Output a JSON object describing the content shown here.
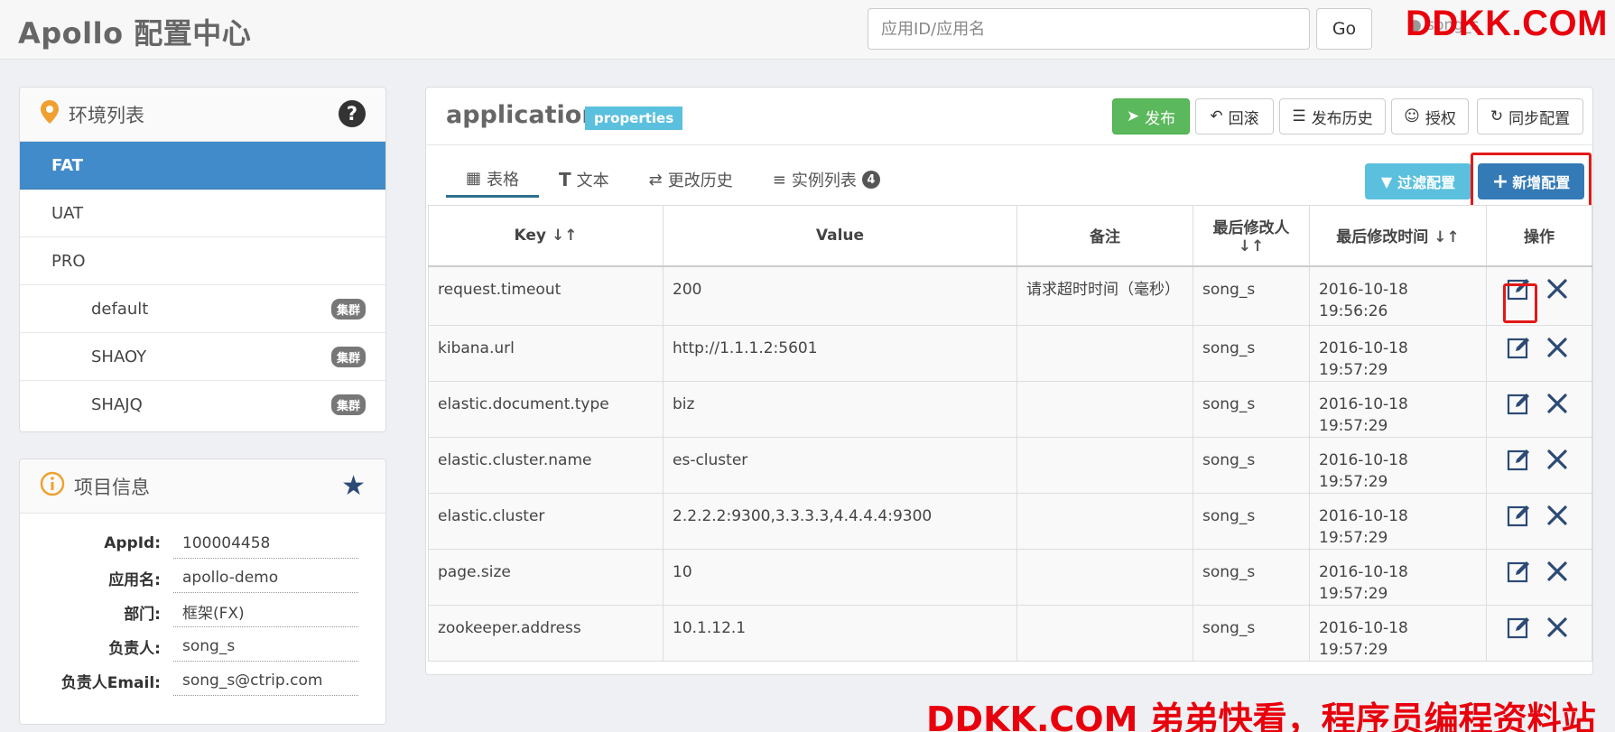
{
  "navbar": {
    "brand": "Apollo 配置中心",
    "search_placeholder": "应用ID/应用名",
    "go_label": "Go",
    "user": "song_s"
  },
  "watermark": {
    "top": "DDKK.COM",
    "bottom": "DDKK.COM 弟弟快看，程序员编程资料站"
  },
  "env_panel": {
    "title": "环境列表",
    "items": [
      {
        "label": "FAT",
        "active": true
      },
      {
        "label": "UAT"
      },
      {
        "label": "PRO"
      },
      {
        "label": "default",
        "badge": "集群"
      },
      {
        "label": "SHAOY",
        "badge": "集群"
      },
      {
        "label": "SHAJQ",
        "badge": "集群"
      }
    ]
  },
  "project_panel": {
    "title": "项目信息",
    "rows": [
      {
        "label": "AppId:",
        "value": "100004458"
      },
      {
        "label": "应用名:",
        "value": "apollo-demo"
      },
      {
        "label": "部门:",
        "value": "框架(FX)"
      },
      {
        "label": "负责人:",
        "value": "song_s"
      },
      {
        "label": "负责人Email:",
        "value": "song_s@ctrip.com"
      }
    ]
  },
  "namespace": {
    "title": "application",
    "format": "properties",
    "actions": {
      "publish": "发布",
      "rollback": "回滚",
      "history": "发布历史",
      "authorize": "授权",
      "sync": "同步配置"
    },
    "tabs": [
      {
        "label": "表格",
        "icon": "table-icon"
      },
      {
        "label": "文本",
        "icon": "text-icon"
      },
      {
        "label": "更改历史",
        "icon": "swap-icon"
      },
      {
        "label": "实例列表",
        "icon": "server-icon",
        "count": "4"
      }
    ],
    "filter_label": "过滤配置",
    "add_label": "新增配置"
  },
  "table": {
    "headers": {
      "key": "Key",
      "value": "Value",
      "comment": "备注",
      "modifier": "最后修改人",
      "modified_time": "最后修改时间",
      "ops": "操作"
    },
    "rows": [
      {
        "key": "request.timeout",
        "value": "200",
        "comment": "请求超时时间（毫秒）",
        "modifier": "song_s",
        "time": "2016-10-18 19:56:26"
      },
      {
        "key": "kibana.url",
        "value": "http://1.1.1.2:5601",
        "comment": "",
        "modifier": "song_s",
        "time": "2016-10-18 19:57:29"
      },
      {
        "key": "elastic.document.type",
        "value": "biz",
        "comment": "",
        "modifier": "song_s",
        "time": "2016-10-18 19:57:29"
      },
      {
        "key": "elastic.cluster.name",
        "value": "es-cluster",
        "comment": "",
        "modifier": "song_s",
        "time": "2016-10-18 19:57:29"
      },
      {
        "key": "elastic.cluster",
        "value": "2.2.2.2:9300,3.3.3.3,4.4.4.4:9300",
        "comment": "",
        "modifier": "song_s",
        "time": "2016-10-18 19:57:29"
      },
      {
        "key": "page.size",
        "value": "10",
        "comment": "",
        "modifier": "song_s",
        "time": "2016-10-18 19:57:29"
      },
      {
        "key": "zookeeper.address",
        "value": "10.1.12.1",
        "comment": "",
        "modifier": "song_s",
        "time": "2016-10-18 19:57:29"
      }
    ]
  },
  "colors": {
    "active_env": "#428bca",
    "publish": "#5cb85c",
    "filter": "#5bc0de",
    "add": "#337ab7",
    "highlight": "#e31818"
  }
}
